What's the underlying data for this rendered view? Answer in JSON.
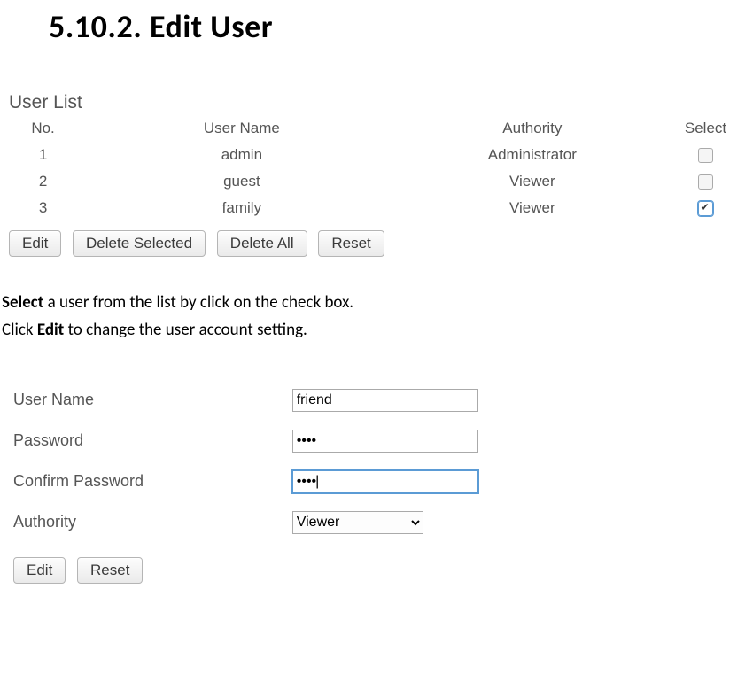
{
  "heading": "5.10.2. Edit User",
  "user_list": {
    "title": "User List",
    "headers": {
      "no": "No.",
      "name": "User Name",
      "authority": "Authority",
      "select": "Select"
    },
    "rows": [
      {
        "no": "1",
        "name": "admin",
        "authority": "Administrator",
        "selected": false
      },
      {
        "no": "2",
        "name": "guest",
        "authority": "Viewer",
        "selected": false
      },
      {
        "no": "3",
        "name": "family",
        "authority": "Viewer",
        "selected": true
      }
    ]
  },
  "buttons": {
    "edit": "Edit",
    "delete_selected": "Delete Selected",
    "delete_all": "Delete All",
    "reset": "Reset"
  },
  "instructions": {
    "line1_bold": "Select",
    "line1_rest": " a user from the list by click on the check box.",
    "line2_pre": "Click ",
    "line2_bold": "Edit",
    "line2_rest": " to change the user account setting."
  },
  "form": {
    "username_label": "User Name",
    "username_value": "friend",
    "password_label": "Password",
    "password_value": "••••",
    "confirm_label": "Confirm Password",
    "confirm_value": "••••",
    "authority_label": "Authority",
    "authority_value": "Viewer",
    "edit": "Edit",
    "reset": "Reset"
  }
}
